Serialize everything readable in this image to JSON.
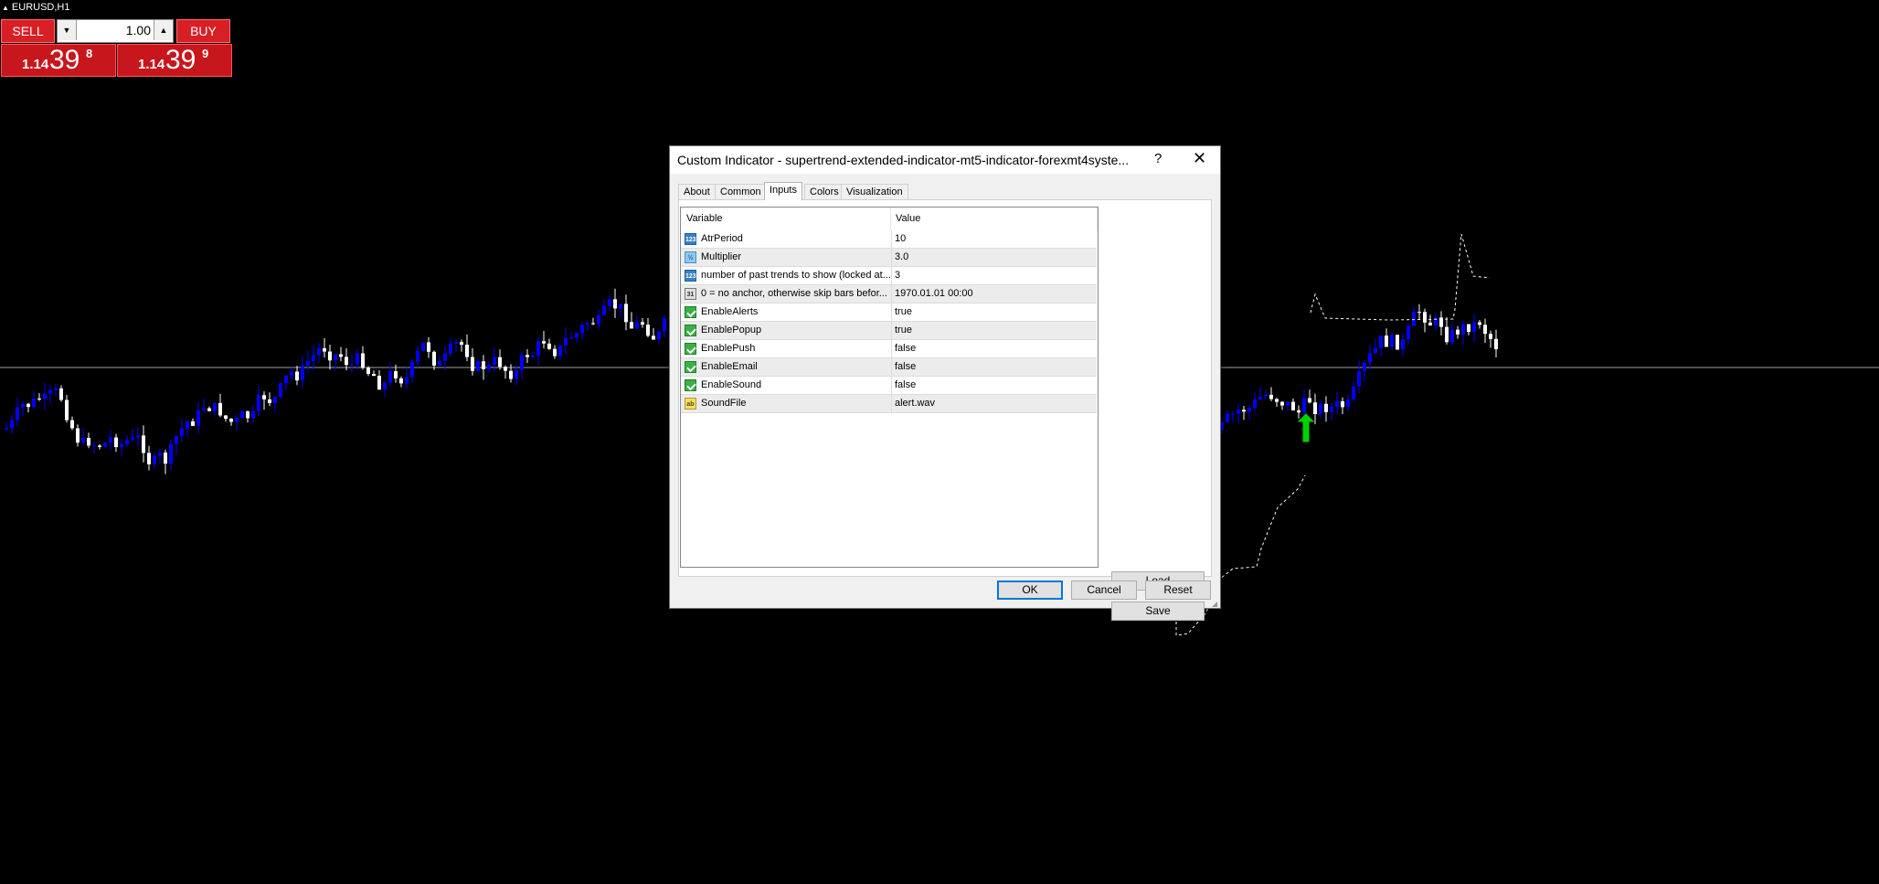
{
  "symbol": "EURUSD,H1",
  "trade": {
    "sell_label": "SELL",
    "buy_label": "BUY",
    "lot": "1.00",
    "sell_price": {
      "small": "1.14",
      "big": "39",
      "sup": "8"
    },
    "buy_price": {
      "small": "1.14",
      "big": "39",
      "sup": "9"
    }
  },
  "colors": {
    "background": "#000000",
    "bull_candle": "#0000ff",
    "bear_candle": "#ffffff",
    "trade_red": "#d91f26",
    "signal_arrow": "#00d000"
  },
  "dialog": {
    "title": "Custom Indicator - supertrend-extended-indicator-mt5-indicator-forexmt4syste...",
    "help": "?",
    "close": "✕",
    "tabs": [
      "About",
      "Common",
      "Inputs",
      "Colors",
      "Visualization"
    ],
    "active_tab": "Inputs",
    "columns": {
      "variable": "Variable",
      "value": "Value"
    },
    "rows": [
      {
        "type": "int",
        "icon": "123",
        "var": "AtrPeriod",
        "val": "10"
      },
      {
        "type": "dbl",
        "icon": "½",
        "var": "Multiplier",
        "val": "3.0"
      },
      {
        "type": "int",
        "icon": "123",
        "var": "number of past trends to show (locked at...",
        "val": "3"
      },
      {
        "type": "dt",
        "icon": "31",
        "var": "0 = no anchor, otherwise skip bars befor...",
        "val": "1970.01.01 00:00"
      },
      {
        "type": "bool",
        "icon": "",
        "var": "EnableAlerts",
        "val": "true"
      },
      {
        "type": "bool",
        "icon": "",
        "var": "EnablePopup",
        "val": "true"
      },
      {
        "type": "bool",
        "icon": "",
        "var": "EnablePush",
        "val": "false"
      },
      {
        "type": "bool",
        "icon": "",
        "var": "EnableEmail",
        "val": "false"
      },
      {
        "type": "bool",
        "icon": "",
        "var": "EnableSound",
        "val": "false"
      },
      {
        "type": "str",
        "icon": "ab",
        "var": "SoundFile",
        "val": "alert.wav"
      }
    ],
    "buttons": {
      "load": "Load",
      "save": "Save",
      "ok": "OK",
      "cancel": "Cancel",
      "reset": "Reset"
    }
  }
}
